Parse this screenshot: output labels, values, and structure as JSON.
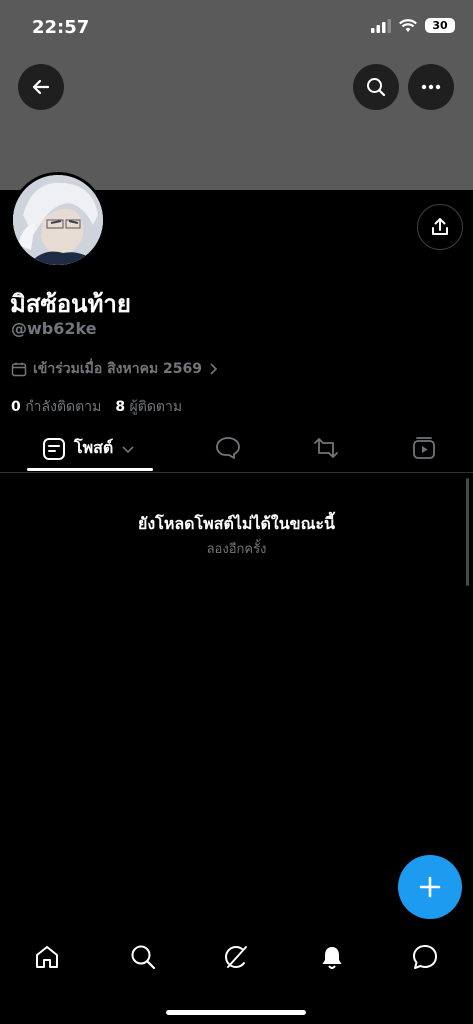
{
  "status": {
    "time": "22:57",
    "battery": "30"
  },
  "profile": {
    "name": "มิสซ้อนท้าย",
    "handle": "@wb62ke",
    "joined": "เข้าร่วมเมื่อ สิงหาคม 2569",
    "following_count": "0",
    "following_label": "กำลังติดตาม",
    "followers_count": "8",
    "followers_label": "ผู้ติดตาม"
  },
  "tabs": {
    "posts_label": "โพสต์"
  },
  "empty_state": {
    "title": "ยังโหลดโพสต์ไม่ได้ในขณะนี้",
    "retry": "ลองอีกครั้ง"
  },
  "colors": {
    "accent": "#1d9bf0",
    "banner": "#5a5a5a",
    "muted": "#71767b"
  },
  "icons": [
    "back-icon",
    "search-icon",
    "more-icon",
    "share-icon",
    "calendar-icon",
    "chevron-right-icon",
    "posts-icon",
    "chevron-down-icon",
    "replies-icon",
    "reposts-icon",
    "media-icon",
    "compose-icon",
    "home-icon",
    "explore-icon",
    "grok-icon",
    "notifications-icon",
    "messages-icon"
  ]
}
